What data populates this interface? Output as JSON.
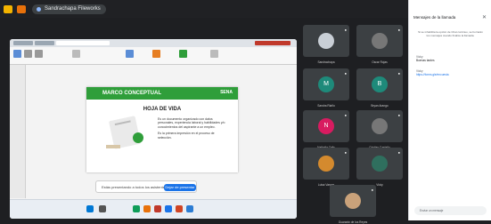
{
  "meeting": {
    "title": "Sandrachapa Fileworks"
  },
  "slide": {
    "header": "MARCO CONCEPTUAL",
    "brand": "SENA",
    "title": "HOJA DE VIDA",
    "text1": "Es un documento organizado con datos personales, experiencia laboral y habilidades y/o conocimientos del aspirante a un empleo.",
    "text2": "Es la primera impresión en el proceso de selección."
  },
  "notification": {
    "text": "Estás presentando a todos los asistentes",
    "button": "Dejar de presentar"
  },
  "participants": [
    {
      "name": "Sandrachapa",
      "initial": "",
      "color": "#c9cfd6"
    },
    {
      "name": "Oscar Rojas",
      "initial": "",
      "color": "#777"
    },
    {
      "name": "Sandra Riaño",
      "initial": "M",
      "color": "#1e8a7a"
    },
    {
      "name": "Bryan Arango",
      "initial": "B",
      "color": "#1e8a7a"
    },
    {
      "name": "Nathalia Celis",
      "initial": "N",
      "color": "#d81b60"
    },
    {
      "name": "Cristian Castaño",
      "initial": "",
      "color": "#777"
    },
    {
      "name": "Luisa Vargas",
      "initial": "",
      "color": "#d48a2e"
    },
    {
      "name": "Vicky",
      "initial": "",
      "color": "#2f6f5e"
    },
    {
      "name": "Guaranin de los Reyes",
      "initial": "",
      "color": "#caa27a"
    }
  ],
  "chat": {
    "title": "Mensajes de la llamada",
    "info": "Si se inhabilita la opción de Chat continuo, se borrarán los mensajes cuando finalice la llamada.",
    "messages": [
      {
        "author": "Vicky",
        "text": "Buenas tardes"
      },
      {
        "author": "Vicky",
        "text": "https://forms.gle/encuesta"
      }
    ],
    "input_placeholder": "Enviar un mensaje"
  }
}
